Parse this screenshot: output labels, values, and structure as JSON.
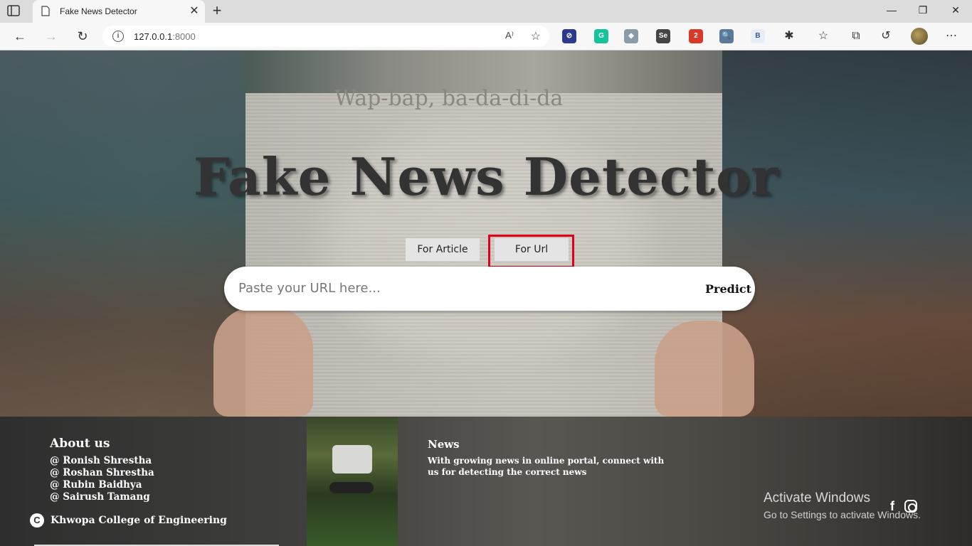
{
  "browser": {
    "tab_title": "Fake News Detector",
    "tab_close": "✕",
    "new_tab": "+",
    "url_host": "127.0.0.1",
    "url_port": ":8000",
    "minimize": "—",
    "maximize": "❐",
    "close": "✕",
    "back": "←",
    "forward": "→",
    "reload": "↻",
    "read_aloud": "A⁾",
    "more": "⋯",
    "extensions": [
      {
        "name": "block-ext-icon",
        "color": "#2b3a8c",
        "label": "⊘"
      },
      {
        "name": "grammarly-ext-icon",
        "color": "#15c39a",
        "label": "G"
      },
      {
        "name": "shield-ext-icon",
        "color": "#8a9aa8",
        "label": "◈"
      },
      {
        "name": "selenium-ext-icon",
        "color": "#444444",
        "label": "Se"
      },
      {
        "name": "translate-ext-icon",
        "color": "#d83a2a",
        "label": "2"
      },
      {
        "name": "search-ext-icon",
        "color": "#5a7a9a",
        "label": "🔍"
      },
      {
        "name": "bitwarden-ext-icon",
        "color": "#e8eef8",
        "label": "B"
      }
    ]
  },
  "hero": {
    "newspaper_headline": "Wap-bap, ba-da-di-da",
    "title": "Fake News Detector",
    "mode_article": "For Article",
    "mode_url": "For Url",
    "input_placeholder": "Paste your URL here...",
    "predict": "Predict"
  },
  "footer": {
    "about_title": "About us",
    "members": [
      "@ Ronish Shrestha",
      "@ Roshan Shrestha",
      "@ Rubin Baidhya",
      "@ Sairush Tamang"
    ],
    "copyright_symbol": "C",
    "college": "Khwopa College of Engineering",
    "news_title": "News",
    "news_text": "With growing news in online portal, connect with us for detecting the correct news",
    "facebook": "f"
  },
  "os_overlay": {
    "activate_title": "Activate Windows",
    "activate_sub": "Go to Settings to activate Windows."
  }
}
